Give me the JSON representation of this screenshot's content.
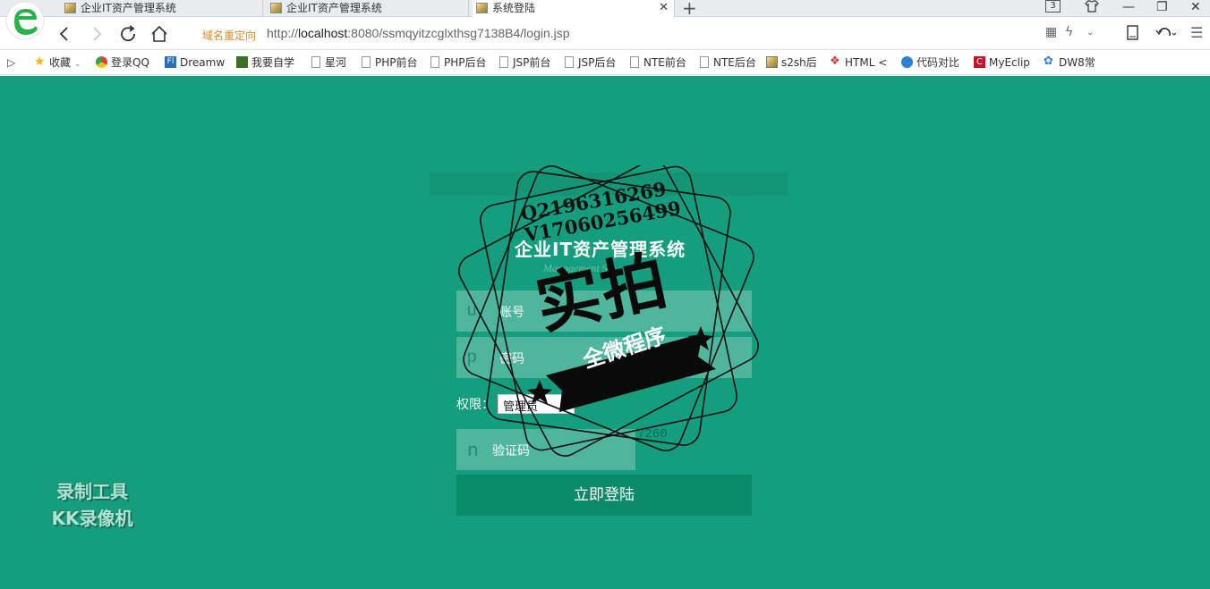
{
  "browser": {
    "tabs": [
      {
        "title": "企业IT资产管理系统",
        "active": false
      },
      {
        "title": "企业IT资产管理系统",
        "active": false
      },
      {
        "title": "系统登陆",
        "active": true
      }
    ],
    "tab_count": "3",
    "redirect_label": "域名重定向",
    "url_prefix": "http://",
    "url_host": "localhost",
    "url_rest": ":8080/ssmqyitzcglxthsg7138B4/login.jsp",
    "bookmarks": [
      {
        "label": "收藏",
        "icon": "star-icon"
      },
      {
        "label": "登录QQ",
        "icon": "chrome-icon"
      },
      {
        "label": "Dreamw",
        "icon": "dreamweaver-icon"
      },
      {
        "label": "我要自学",
        "icon": "leaf-icon"
      },
      {
        "label": "星河",
        "icon": "page-icon"
      },
      {
        "label": "PHP前台",
        "icon": "page-icon"
      },
      {
        "label": "PHP后台",
        "icon": "page-icon"
      },
      {
        "label": "JSP前台",
        "icon": "page-icon"
      },
      {
        "label": "JSP后台",
        "icon": "page-icon"
      },
      {
        "label": "NTE前台",
        "icon": "page-icon"
      },
      {
        "label": "NTE后台",
        "icon": "page-icon"
      },
      {
        "label": "s2sh后",
        "icon": "image-icon"
      },
      {
        "label": "HTML <",
        "icon": "html-icon"
      },
      {
        "label": "代码对比",
        "icon": "compare-icon"
      },
      {
        "label": "MyEclip",
        "icon": "myeclipse-icon"
      },
      {
        "label": "DW8常",
        "icon": "paw-icon"
      }
    ]
  },
  "login": {
    "title": "企业IT资产管理系统",
    "subtitle": "Management Sy",
    "username_icon": "u",
    "username_placeholder": "账号",
    "password_icon": "p",
    "password_placeholder": "密码",
    "role_label": "权限：",
    "role_value": "管理员",
    "captcha_icon": "n",
    "captcha_placeholder": "验证码",
    "captcha_code": "7260",
    "submit_label": "立即登陆"
  },
  "watermark": {
    "qq_line1": "Q2196316269",
    "qq_line2": "V17060256499",
    "big_text": "实拍",
    "band_text": "全微程序",
    "recorder_line1": "录制工具",
    "recorder_line2": "KK录像机"
  },
  "colors": {
    "page_bg": "#159e7d",
    "button_bg": "#0b8a69",
    "redirect": "#e08a2a"
  }
}
